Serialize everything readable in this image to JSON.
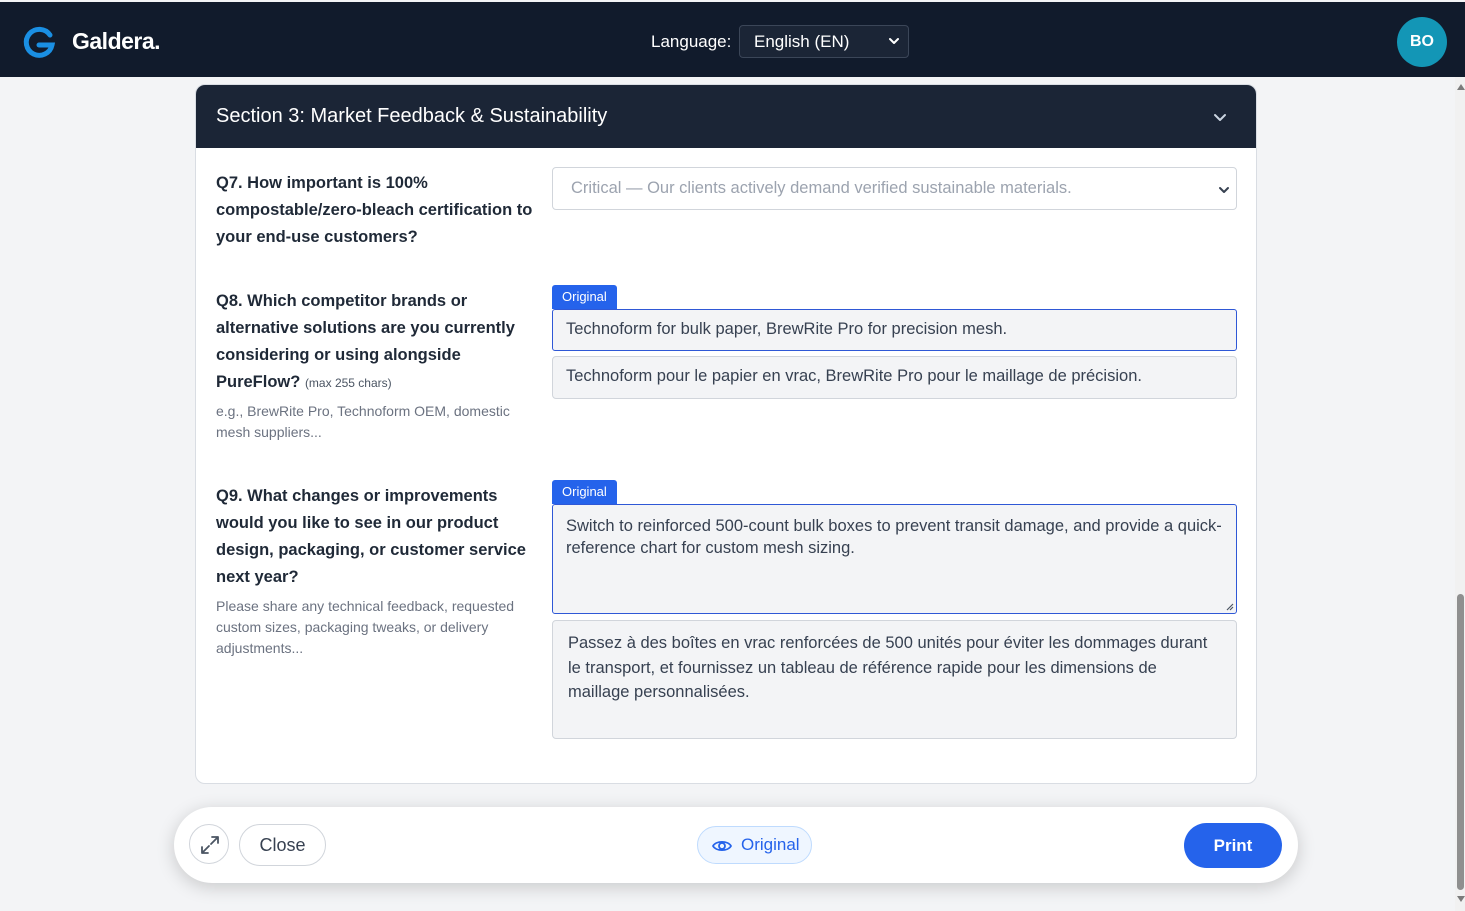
{
  "header": {
    "brand": "Galdera.",
    "language_label": "Language:",
    "language_value": "English (EN)",
    "avatar_initials": "BO",
    "colors": {
      "bg": "#111b2c",
      "avatar": "#1396b6",
      "logo": "#1a8fe3"
    }
  },
  "section": {
    "title": "Section 3: Market Feedback & Sustainability",
    "q7": {
      "label": "Q7. How important is 100% compostable/zero-bleach certification to your end-use customers?",
      "selected": "Critical — Our clients actively demand verified sustainable materials."
    },
    "q8": {
      "label": "Q8. Which competitor brands or alternative solutions are you currently considering or using alongside PureFlow?",
      "hint": "(max 255 chars)",
      "help": "e.g., BrewRite Pro, Technoform OEM, domestic mesh suppliers...",
      "tag": "Original",
      "original_value": "Technoform for bulk paper, BrewRite Pro for precision mesh.",
      "translation": "Technoform pour le papier en vrac, BrewRite Pro pour le maillage de précision."
    },
    "q9": {
      "label": "Q9. What changes or improvements would you like to see in our product design, packaging, or customer service next year?",
      "help": "Please share any technical feedback, requested custom sizes, packaging tweaks, or delivery adjustments...",
      "tag": "Original",
      "original_value": "Switch to reinforced 500-count bulk boxes to prevent transit damage, and provide a quick-reference chart for custom mesh sizing.",
      "translation": "Passez à des boîtes en vrac renforcées de 500 unités pour éviter les dommages durant le transport, et fournissez un tableau de référence rapide pour les dimensions de maillage personnalisées."
    }
  },
  "bottom_bar": {
    "close_label": "Close",
    "original_label": "Original",
    "print_label": "Print",
    "accent": "#2563eb"
  }
}
